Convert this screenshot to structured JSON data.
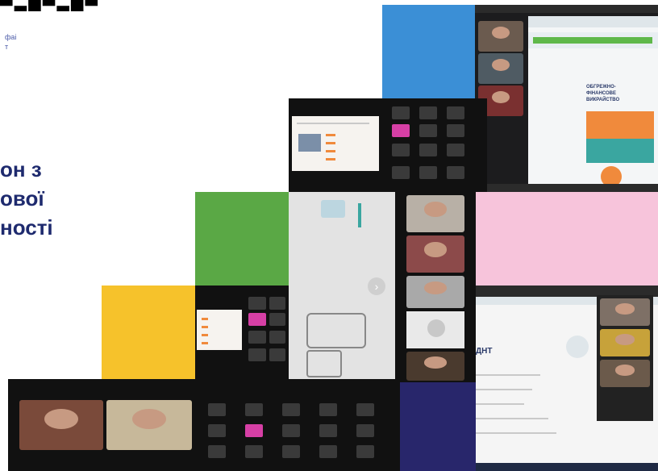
{
  "logo": {
    "text": "▀▄█▀▄█▀"
  },
  "org": {
    "line1": "фаі",
    "line2": "т"
  },
  "title": {
    "line1": "он з",
    "line2": "ової",
    "line3": "ності"
  },
  "slide_a": {
    "heading": "ОБГРЕЖНО-\nФІНАНСОВЕ\nВИКРАЙСТВО"
  },
  "slide_b": {
    "heading": "ДНТ"
  },
  "colors": {
    "blue": "#3b8fd6",
    "green": "#5aa845",
    "yellow": "#f6c22b",
    "pink": "#f7c4db",
    "navy": "#28266b",
    "title": "#1e2a6e"
  }
}
